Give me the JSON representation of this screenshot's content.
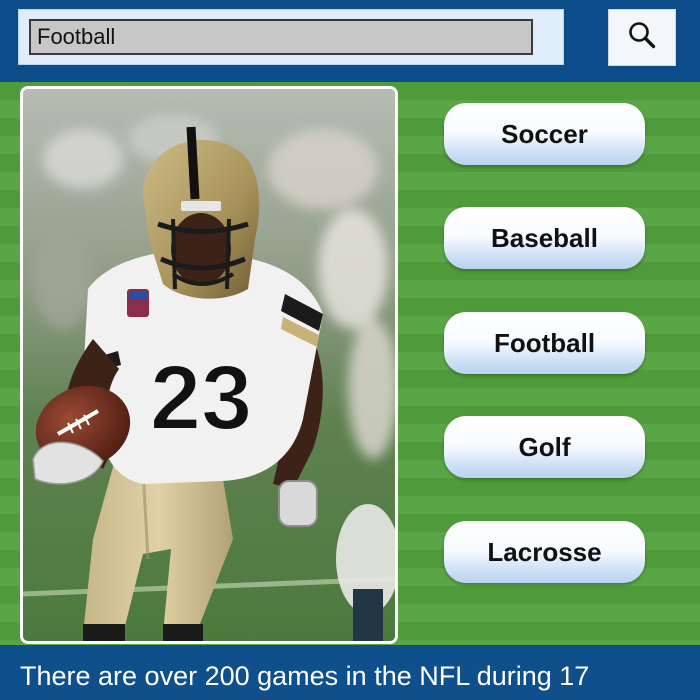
{
  "search": {
    "value": "Football",
    "icon": "search-icon"
  },
  "photo": {
    "subject": "football-player-image",
    "jersey_number": "23"
  },
  "sports": [
    {
      "label": "Soccer"
    },
    {
      "label": "Baseball"
    },
    {
      "label": "Football"
    },
    {
      "label": "Golf"
    },
    {
      "label": "Lacrosse"
    }
  ],
  "fact": {
    "text": "There are over 200 games in the NFL during 17"
  },
  "colors": {
    "header_bg": "#0d4c8a",
    "field_green": "#56a242",
    "button_blue": "#cfe1f6"
  }
}
